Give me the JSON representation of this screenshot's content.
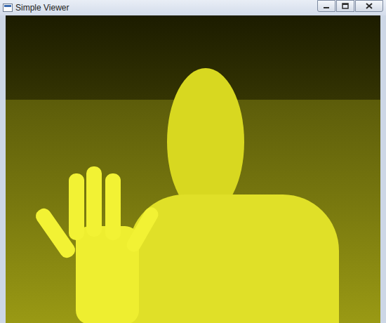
{
  "window": {
    "title": "Simple Viewer"
  }
}
